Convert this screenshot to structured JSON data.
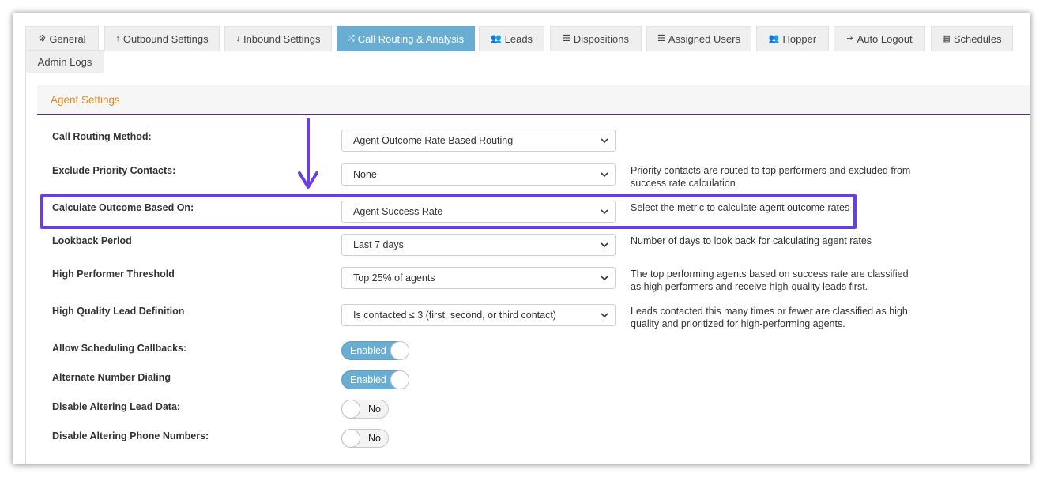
{
  "tabs": [
    {
      "label": "General",
      "icon": "gears-icon",
      "glyph": "⚙"
    },
    {
      "label": "Outbound Settings",
      "icon": "arrow-up-icon",
      "glyph": "↑"
    },
    {
      "label": "Inbound Settings",
      "icon": "arrow-down-icon",
      "glyph": "↓"
    },
    {
      "label": "Call Routing & Analysis",
      "icon": "shuffle-icon",
      "glyph": "⤮"
    },
    {
      "label": "Leads",
      "icon": "users-icon",
      "glyph": "👥"
    },
    {
      "label": "Dispositions",
      "icon": "list-icon",
      "glyph": "☰"
    },
    {
      "label": "Assigned Users",
      "icon": "ordered-list-icon",
      "glyph": "☰"
    },
    {
      "label": "Hopper",
      "icon": "users-icon",
      "glyph": "👥"
    },
    {
      "label": "Auto Logout",
      "icon": "sign-out-icon",
      "glyph": "⇥"
    },
    {
      "label": "Schedules",
      "icon": "calendar-icon",
      "glyph": "▦"
    },
    {
      "label": "Admin Logs",
      "icon": "",
      "glyph": ""
    }
  ],
  "active_tab": "Call Routing & Analysis",
  "panel": {
    "title": "Agent Settings"
  },
  "rows": {
    "routing_method": {
      "label": "Call Routing Method:",
      "value": "Agent Outcome Rate Based Routing"
    },
    "exclude_priority": {
      "label": "Exclude Priority Contacts:",
      "value": "None",
      "help": "Priority contacts are routed to top performers and excluded from success rate calculation"
    },
    "calculate_outcome": {
      "label": "Calculate Outcome Based On:",
      "value": "Agent Success Rate",
      "help": "Select the metric to calculate agent outcome rates"
    },
    "lookback": {
      "label": "Lookback Period",
      "value": "Last 7 days",
      "help": "Number of days to look back for calculating agent rates"
    },
    "high_performer": {
      "label": "High Performer Threshold",
      "value": "Top 25% of agents",
      "help": "The top performing agents based on success rate are classified as high performers and receive high-quality leads first."
    },
    "high_quality": {
      "label": "High Quality Lead Definition",
      "value": "Is contacted ≤ 3 (first, second, or third contact)",
      "help": "Leads contacted this many times or fewer are classified as high quality and prioritized for high-performing agents."
    },
    "scheduling_callbacks": {
      "label": "Allow Scheduling Callbacks:",
      "state": "Enabled"
    },
    "alternate_dialing": {
      "label": "Alternate Number Dialing",
      "state": "Enabled"
    },
    "disable_lead_data": {
      "label": "Disable Altering Lead Data:",
      "state": "No"
    },
    "disable_phone_numbers": {
      "label": "Disable Altering Phone Numbers:",
      "state": "No"
    }
  },
  "colors": {
    "active_tab": "#6aadd3",
    "panel_title": "#e08a1e",
    "highlight": "#6a3fe0",
    "toggle_on": "#6aadd3"
  }
}
